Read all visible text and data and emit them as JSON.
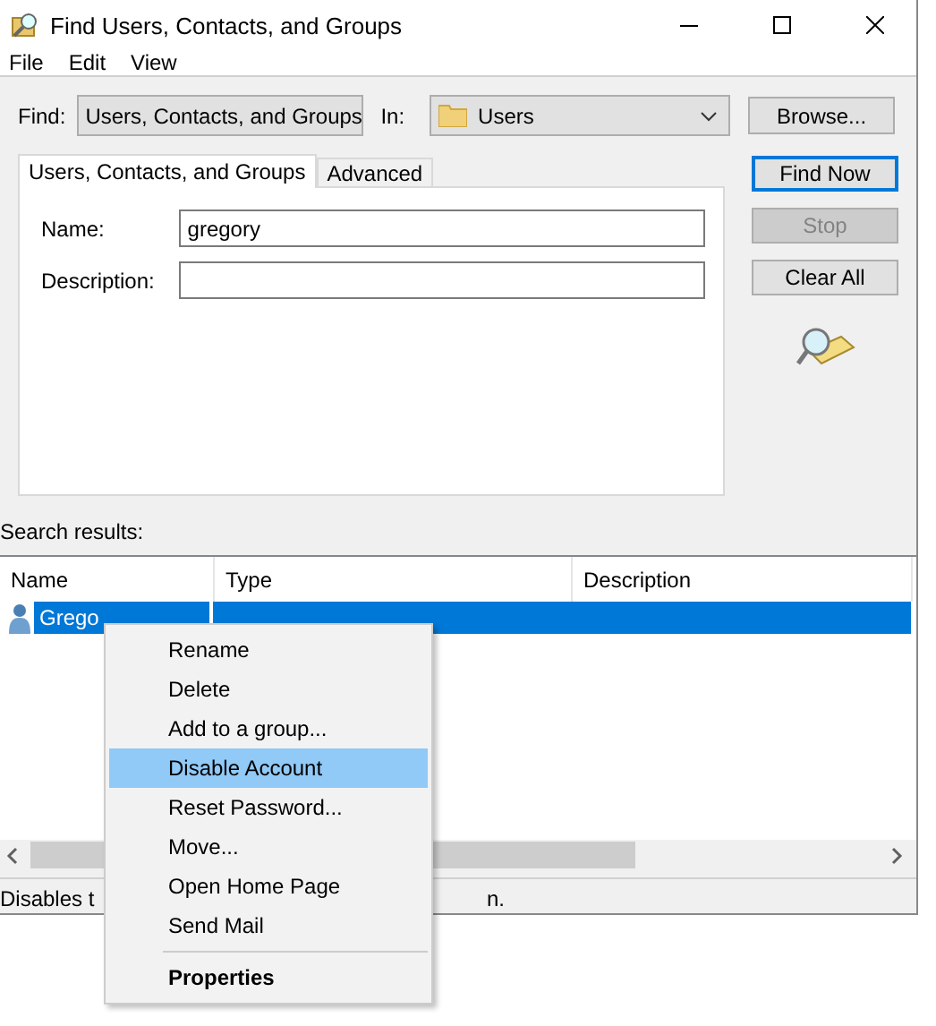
{
  "window": {
    "title": "Find Users, Contacts, and Groups"
  },
  "menu_bar": [
    "File",
    "Edit",
    "View"
  ],
  "find": {
    "label": "Find:",
    "value": "Users, Contacts, and Groups"
  },
  "in": {
    "label": "In:",
    "value": "Users"
  },
  "browse_button": "Browse...",
  "tabs": [
    {
      "label": "Users, Contacts, and Groups",
      "selected": true
    },
    {
      "label": "Advanced",
      "selected": false
    }
  ],
  "fields": [
    {
      "label": "Name:",
      "value": "gregory"
    },
    {
      "label": "Description:"
    }
  ],
  "buttons": [
    {
      "label": "Find Now",
      "disabled": false,
      "default": true
    },
    {
      "label": "Stop",
      "disabled": true,
      "default": false
    },
    {
      "label": "Clear All",
      "disabled": false,
      "default": false
    }
  ],
  "search_results_label": "Search results:",
  "table": {
    "columns": [
      "Name",
      "Type",
      "Description"
    ],
    "rows": [
      {
        "name": "Grego",
        "selected": true
      }
    ]
  },
  "status_bar": {
    "text_start": "Disables t",
    "text_end": "n."
  },
  "context_menu": [
    {
      "label": "Rename",
      "selected": false,
      "bold": false,
      "separator_before": false
    },
    {
      "label": "Delete",
      "selected": false,
      "bold": false,
      "separator_before": false
    },
    {
      "label": "Add to a group...",
      "selected": false,
      "bold": false,
      "separator_before": false
    },
    {
      "label": "Disable Account",
      "selected": true,
      "bold": false,
      "separator_before": false
    },
    {
      "label": "Reset Password...",
      "selected": false,
      "bold": false,
      "separator_before": false
    },
    {
      "label": "Move...",
      "selected": false,
      "bold": false,
      "separator_before": false
    },
    {
      "label": "Open Home Page",
      "selected": false,
      "bold": false,
      "separator_before": false
    },
    {
      "label": "Send Mail",
      "selected": false,
      "bold": false,
      "separator_before": false
    },
    {
      "label": "Properties",
      "selected": false,
      "bold": true,
      "separator_before": true
    }
  ]
}
